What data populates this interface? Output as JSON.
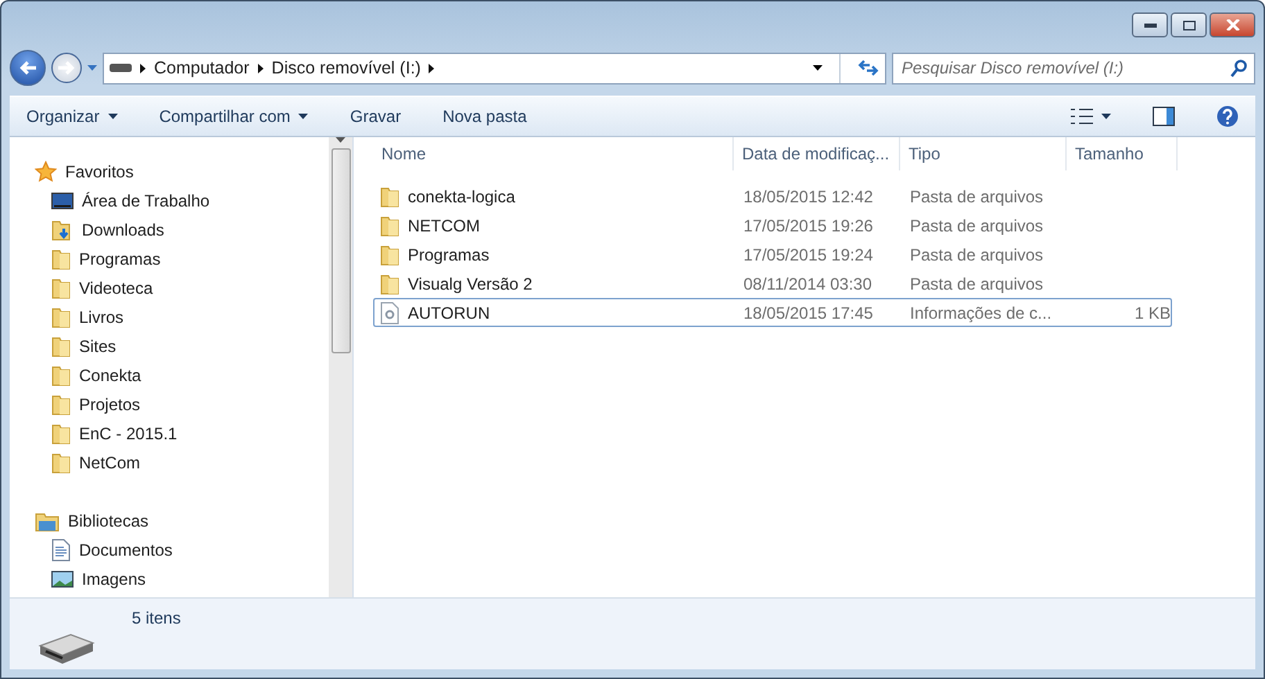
{
  "address": {
    "crumbs": [
      "Computador",
      "Disco removível (I:)"
    ]
  },
  "search": {
    "placeholder": "Pesquisar Disco removível (I:)"
  },
  "toolbar": [
    {
      "label": "Organizar",
      "dropdown": true
    },
    {
      "label": "Compartilhar com",
      "dropdown": true
    },
    {
      "label": "Gravar",
      "dropdown": false
    },
    {
      "label": "Nova pasta",
      "dropdown": false
    }
  ],
  "sidebar": [
    {
      "label": "Favoritos",
      "kind": "favorites",
      "children": [
        {
          "label": "Área de Trabalho",
          "kind": "desktop"
        },
        {
          "label": "Downloads",
          "kind": "downloads"
        },
        {
          "label": "Programas",
          "kind": "folder"
        },
        {
          "label": "Videoteca",
          "kind": "folder"
        },
        {
          "label": "Livros",
          "kind": "folder"
        },
        {
          "label": "Sites",
          "kind": "folder"
        },
        {
          "label": "Conekta",
          "kind": "folder"
        },
        {
          "label": "Projetos",
          "kind": "folder"
        },
        {
          "label": "EnC - 2015.1",
          "kind": "folder"
        },
        {
          "label": "NetCom",
          "kind": "folder"
        }
      ]
    },
    {
      "label": "Bibliotecas",
      "kind": "libraries",
      "children": [
        {
          "label": "Documentos",
          "kind": "documents"
        },
        {
          "label": "Imagens",
          "kind": "images"
        }
      ]
    }
  ],
  "table": {
    "columns": [
      "Nome",
      "Data de modificaç...",
      "Tipo",
      "Tamanho"
    ],
    "rows": [
      {
        "kind": "folder",
        "focused": false,
        "cells": [
          "conekta-logica",
          "18/05/2015 12:42",
          "Pasta de arquivos",
          ""
        ]
      },
      {
        "kind": "folder",
        "focused": false,
        "cells": [
          "NETCOM",
          "17/05/2015 19:26",
          "Pasta de arquivos",
          ""
        ]
      },
      {
        "kind": "folder",
        "focused": false,
        "cells": [
          "Programas",
          "17/05/2015 19:24",
          "Pasta de arquivos",
          ""
        ]
      },
      {
        "kind": "folder",
        "focused": false,
        "cells": [
          "Visualg Versão 2",
          "08/11/2014 03:30",
          "Pasta de arquivos",
          ""
        ]
      },
      {
        "kind": "settings-file",
        "focused": true,
        "cells": [
          "AUTORUN",
          "18/05/2015 17:45",
          "Informações de c...",
          "1 KB"
        ]
      }
    ]
  },
  "status_bar": {
    "count": "5 itens"
  }
}
